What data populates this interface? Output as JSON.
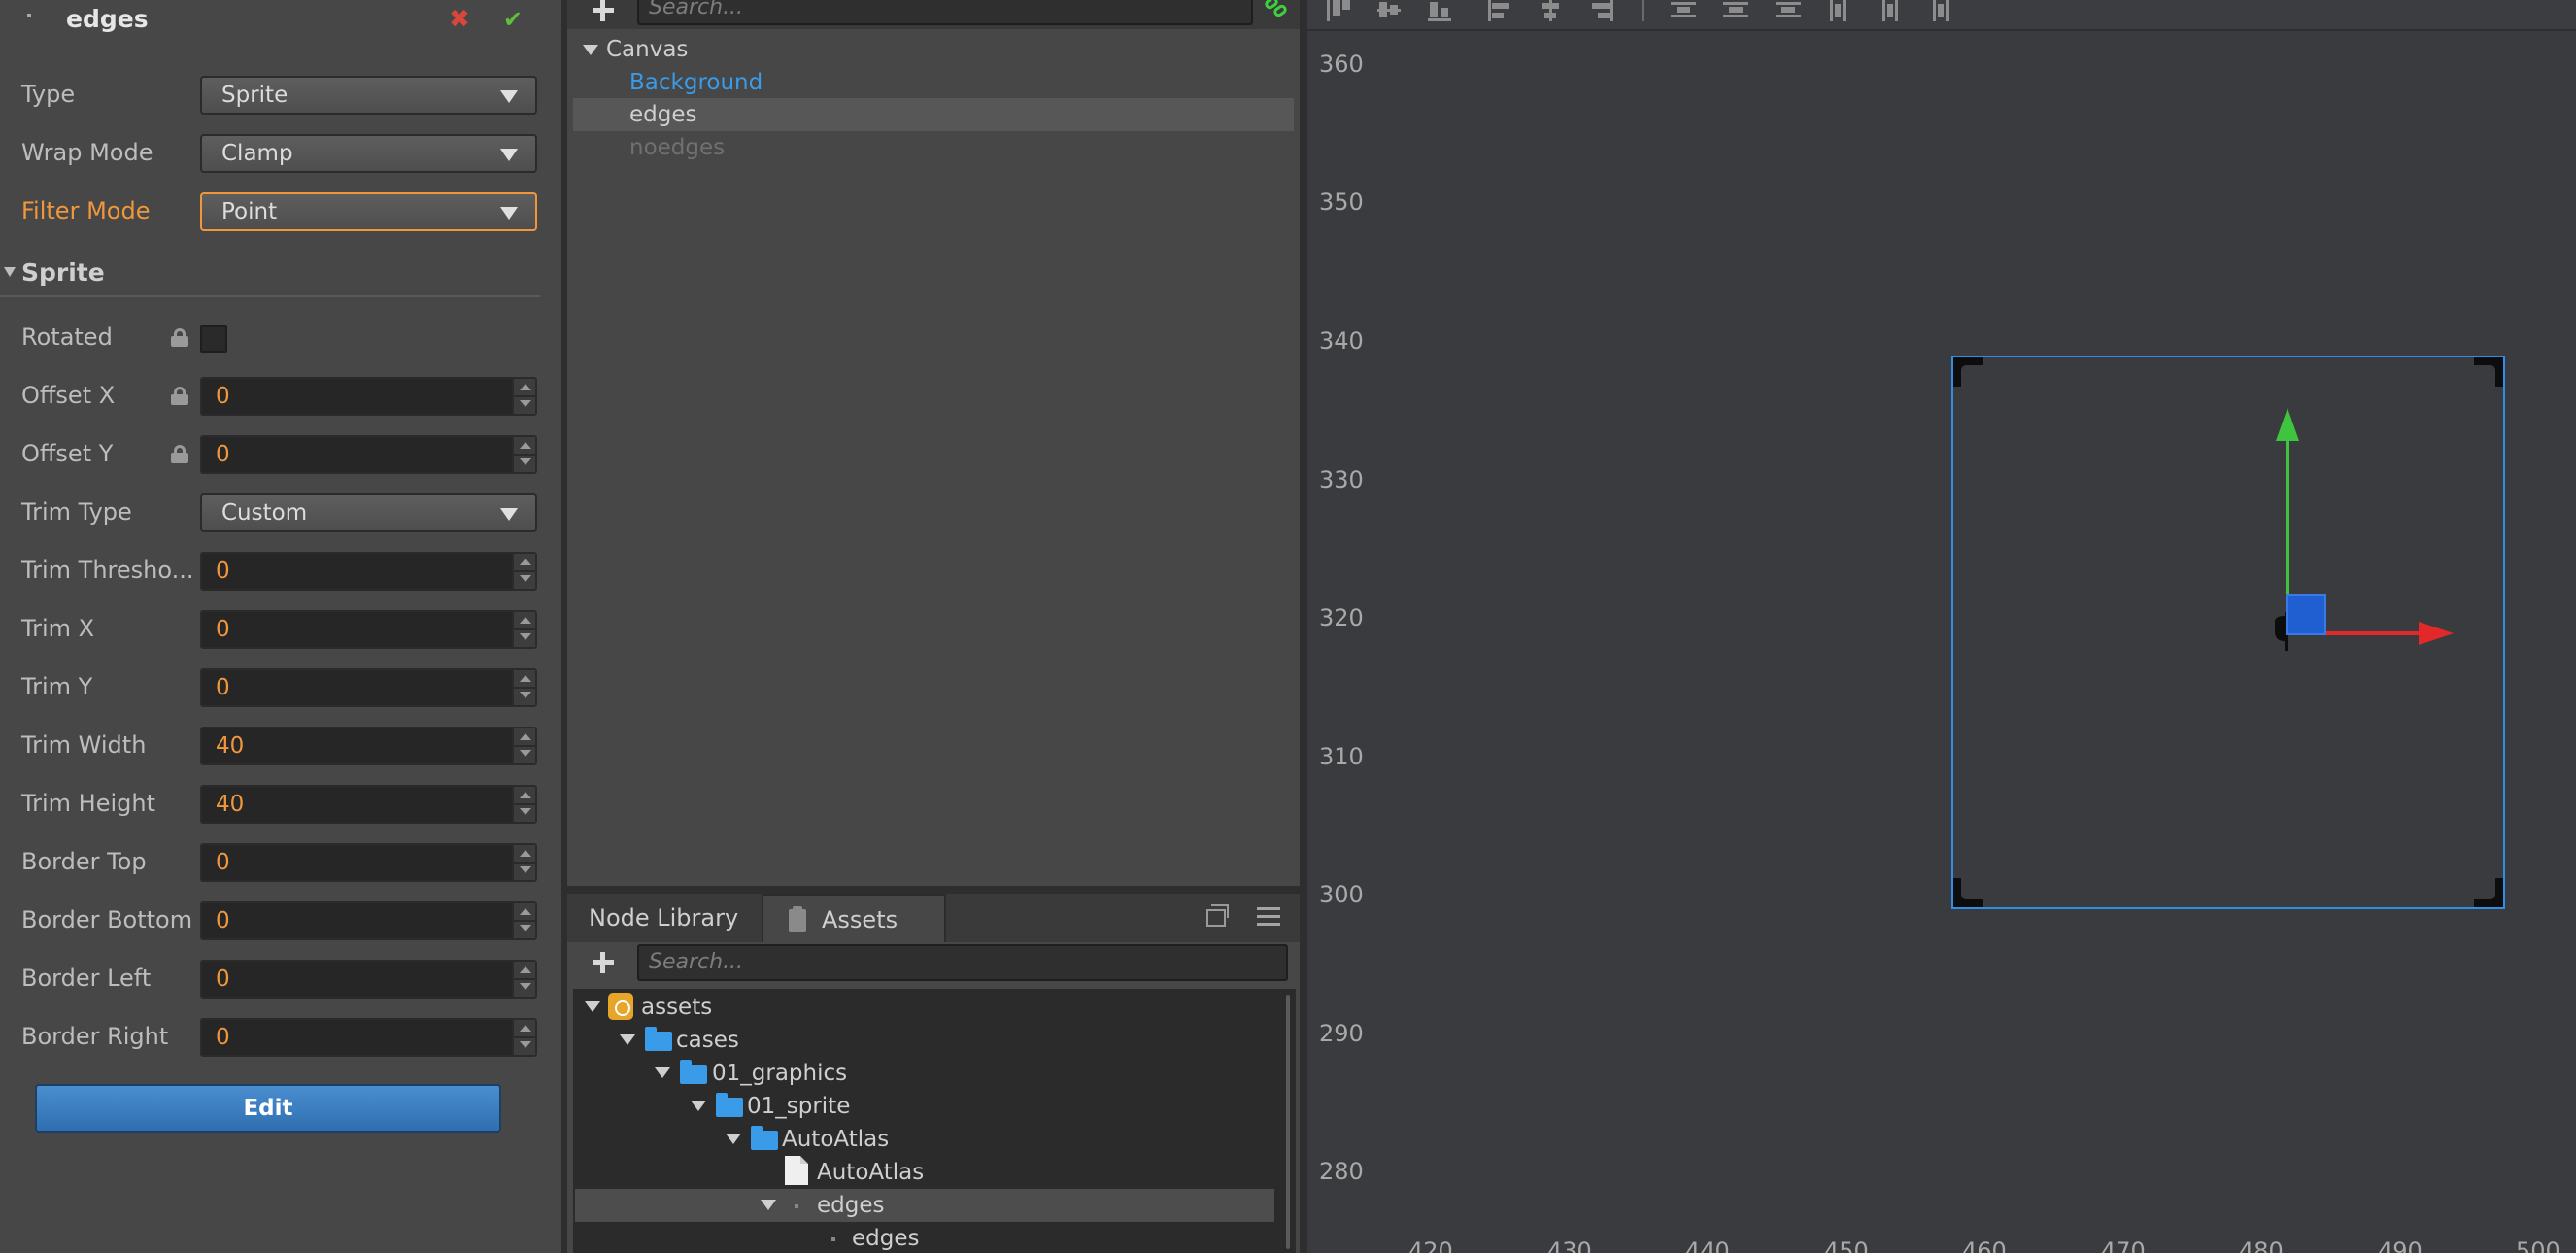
{
  "inspector": {
    "node_title": "edges",
    "texture_props": [
      {
        "label": "Type",
        "value": "Sprite"
      },
      {
        "label": "Wrap Mode",
        "value": "Clamp"
      },
      {
        "label": "Filter Mode",
        "value": "Point"
      }
    ],
    "sprite_section": "Sprite",
    "rotated_label": "Rotated",
    "fields": [
      {
        "label": "Offset X",
        "value": "0"
      },
      {
        "label": "Offset Y",
        "value": "0"
      },
      {
        "label": "Trim Type",
        "value": "Custom"
      },
      {
        "label": "Trim Thresho...",
        "value": "0"
      },
      {
        "label": "Trim X",
        "value": "0"
      },
      {
        "label": "Trim Y",
        "value": "0"
      },
      {
        "label": "Trim Width",
        "value": "40"
      },
      {
        "label": "Trim Height",
        "value": "40"
      },
      {
        "label": "Border Top",
        "value": "0"
      },
      {
        "label": "Border Bottom",
        "value": "0"
      },
      {
        "label": "Border Left",
        "value": "0"
      },
      {
        "label": "Border Right",
        "value": "0"
      }
    ],
    "edit_button": "Edit"
  },
  "hierarchy": {
    "search_placeholder": "Search...",
    "nodes": [
      "Canvas",
      "Background",
      "edges",
      "noedges"
    ]
  },
  "assets": {
    "tabs": [
      "Node Library",
      "Assets"
    ],
    "search_placeholder": "Search...",
    "tree": [
      "assets",
      "cases",
      "01_graphics",
      "01_sprite",
      "AutoAtlas",
      "AutoAtlas",
      "edges",
      "edges"
    ]
  },
  "scene": {
    "y_ruler": [
      "360",
      "350",
      "340",
      "330",
      "320",
      "310",
      "300",
      "290",
      "280"
    ],
    "x_ruler": [
      "420",
      "430",
      "440",
      "450",
      "460",
      "470",
      "480",
      "490",
      "500"
    ]
  },
  "colors": {
    "accent_orange": "#f0973d",
    "selection_blue": "#2d8fe8",
    "link_blue": "#3a9be8",
    "close_red": "#d9463c",
    "confirm_green": "#5fbf3c"
  },
  "icons": [
    "close-icon",
    "check-icon",
    "lock-icon",
    "plus-icon",
    "link-icon",
    "clipboard-icon",
    "maximize-icon",
    "menu-icon",
    "folder-icon",
    "package-icon",
    "file-icon",
    "align-icon"
  ]
}
